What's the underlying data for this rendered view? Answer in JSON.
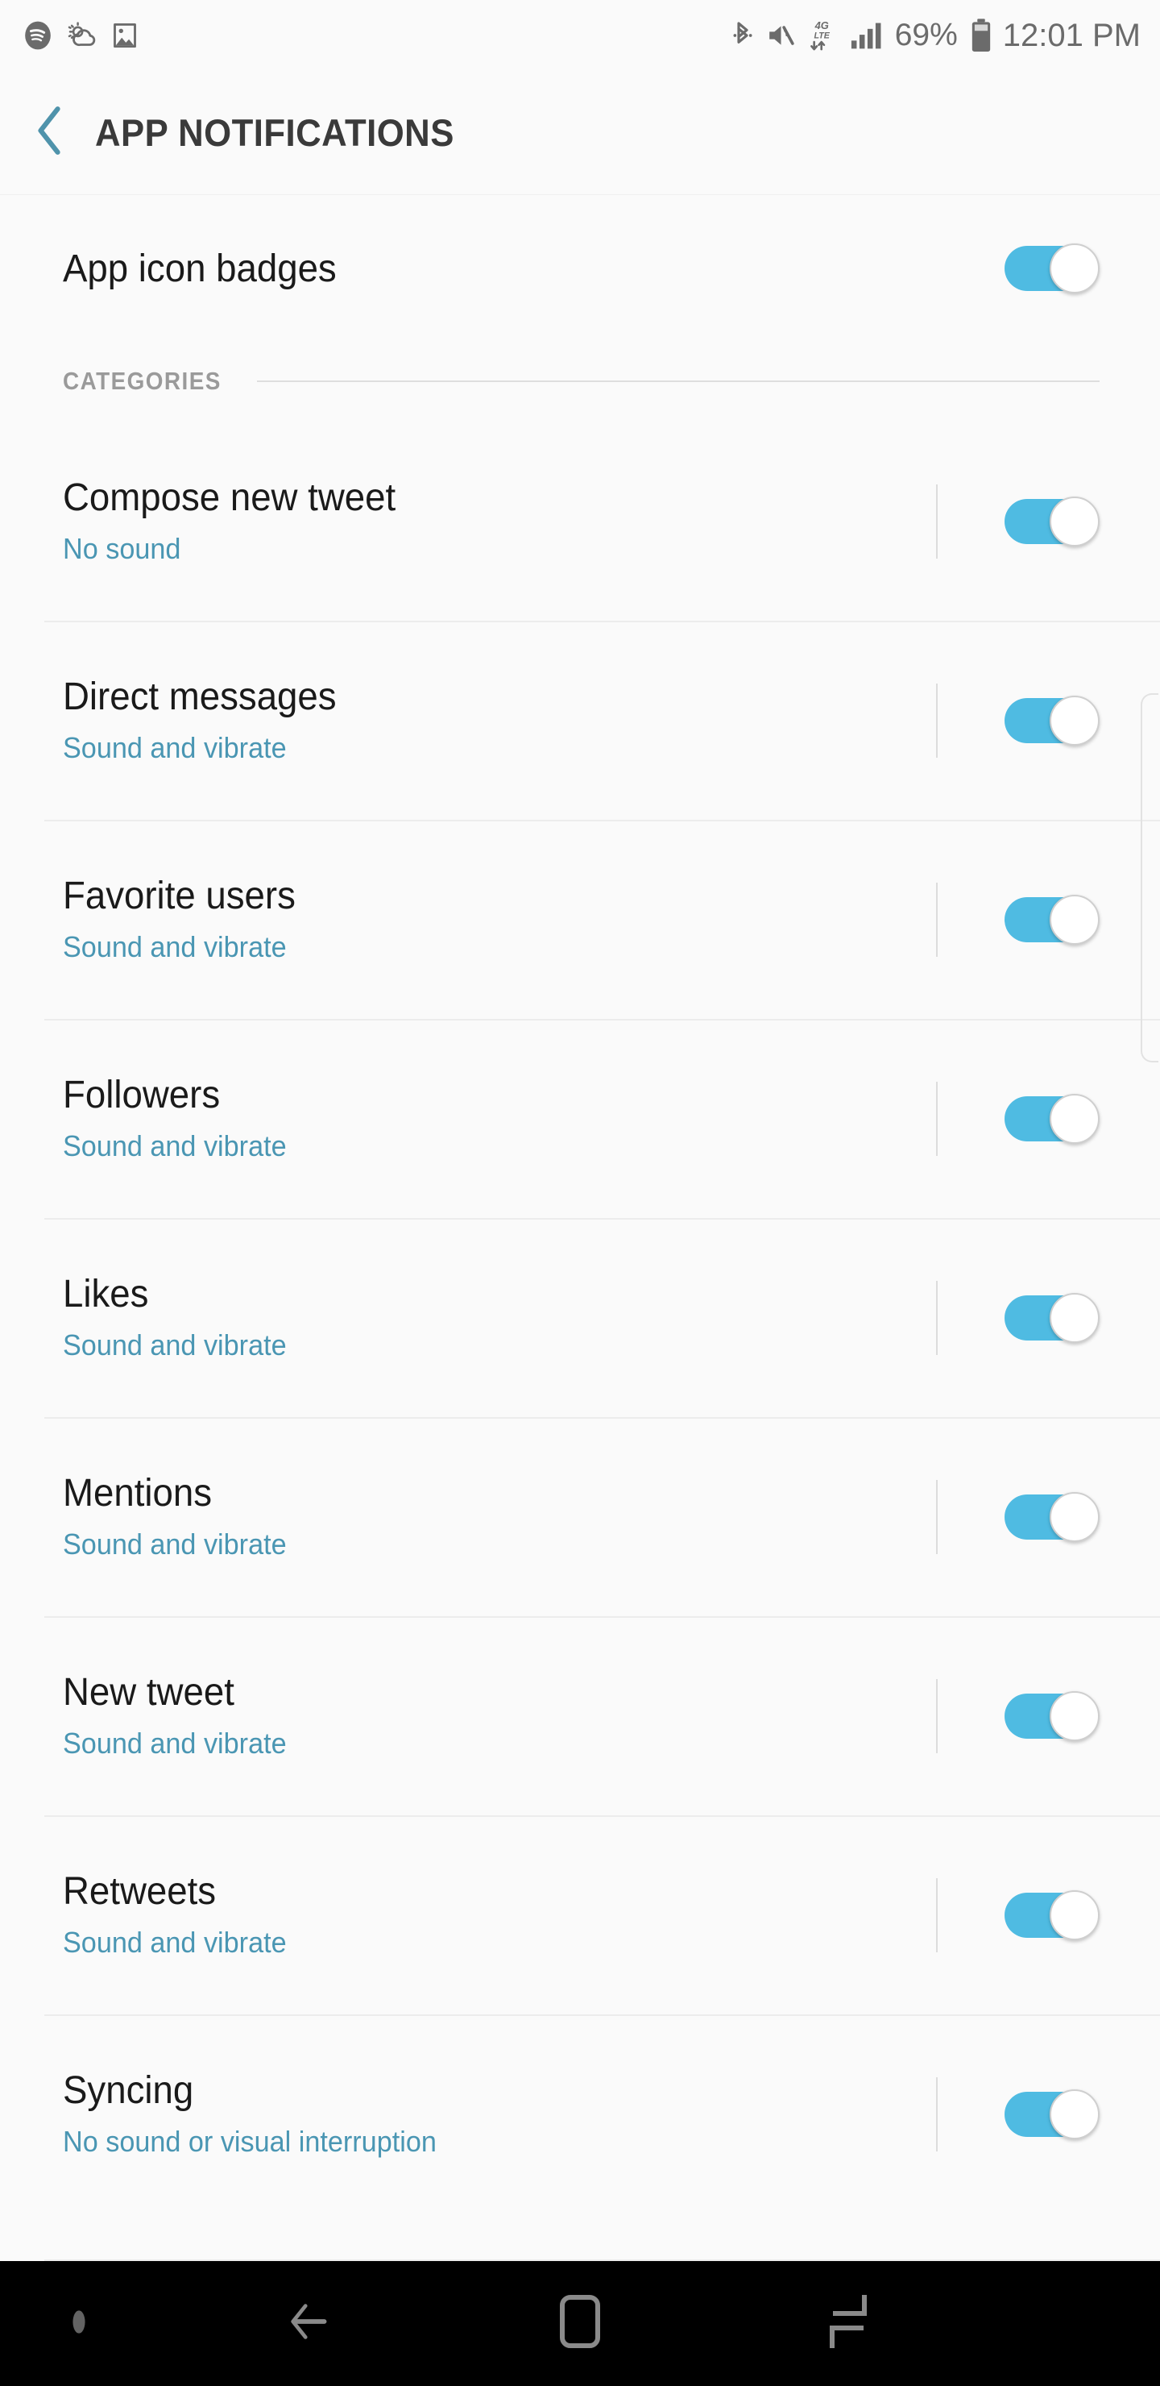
{
  "status_bar": {
    "left_icons": [
      "spotify-icon",
      "weather-partly-cloudy-icon",
      "image-icon"
    ],
    "right_icons": [
      "bluetooth-icon",
      "volume-mute-icon",
      "4g-lte-data-icon",
      "signal-bars-icon",
      "battery-icon"
    ],
    "battery_percent": "69%",
    "network_label": "4G",
    "network_sublabel": "LTE",
    "time": "12:01 PM"
  },
  "header": {
    "title": "APP NOTIFICATIONS",
    "back_icon": "back-chevron-icon"
  },
  "top_setting": {
    "label": "App icon badges",
    "toggle_on": true
  },
  "section": {
    "title": "CATEGORIES"
  },
  "categories": [
    {
      "title": "Compose new tweet",
      "subtitle": "No sound",
      "toggle_on": true
    },
    {
      "title": "Direct messages",
      "subtitle": "Sound and vibrate",
      "toggle_on": true
    },
    {
      "title": "Favorite users",
      "subtitle": "Sound and vibrate",
      "toggle_on": true
    },
    {
      "title": "Followers",
      "subtitle": "Sound and vibrate",
      "toggle_on": true
    },
    {
      "title": "Likes",
      "subtitle": "Sound and vibrate",
      "toggle_on": true
    },
    {
      "title": "Mentions",
      "subtitle": "Sound and vibrate",
      "toggle_on": true
    },
    {
      "title": "New tweet",
      "subtitle": "Sound and vibrate",
      "toggle_on": true
    },
    {
      "title": "Retweets",
      "subtitle": "Sound and vibrate",
      "toggle_on": true
    },
    {
      "title": "Syncing",
      "subtitle": "No sound or visual interruption",
      "toggle_on": true
    }
  ],
  "nav_bar": {
    "items": [
      "nav-dot-icon",
      "back-arrow-icon",
      "home-icon",
      "recents-icon"
    ]
  },
  "colors": {
    "accent_toggle": "#4fbbe2",
    "subtitle_text": "#4a96b3",
    "background": "#fafafa",
    "title_text": "#1a1a1a",
    "section_text": "#9a9a9a",
    "navbar_background": "#000000"
  }
}
